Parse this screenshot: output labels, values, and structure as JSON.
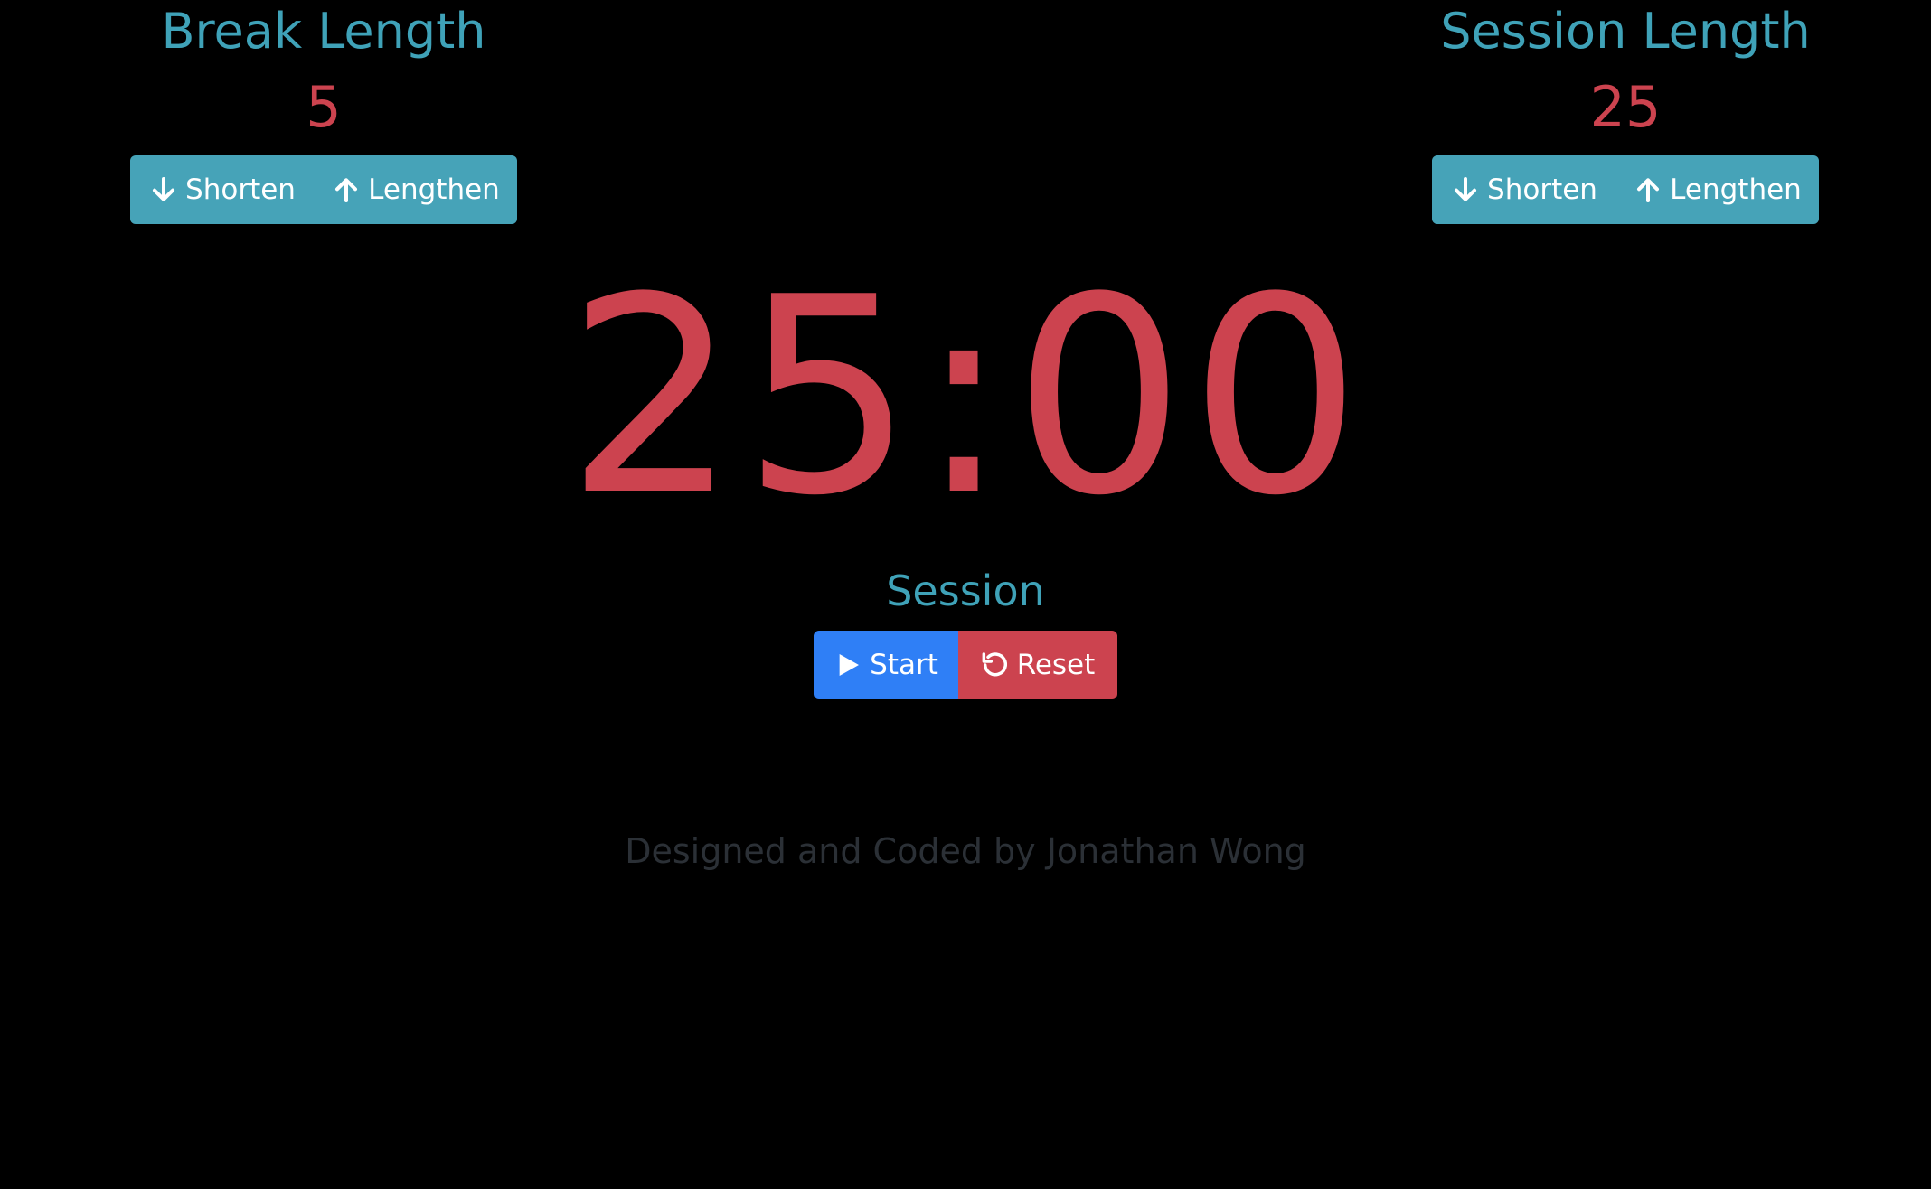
{
  "colors": {
    "background": "#000000",
    "heading": "#3fa2b8",
    "value": "#cc434f",
    "info_button": "#46a3b8",
    "primary_button": "#2f7ff6",
    "danger_button": "#cc434f",
    "credit_text": "#2b3036"
  },
  "break_panel": {
    "title": "Break Length",
    "value": "5",
    "shorten_label": "Shorten",
    "lengthen_label": "Lengthen"
  },
  "session_panel": {
    "title": "Session Length",
    "value": "25",
    "shorten_label": "Shorten",
    "lengthen_label": "Lengthen"
  },
  "timer": {
    "display": "25:00",
    "mode": "Session"
  },
  "controls": {
    "start_label": "Start",
    "reset_label": "Reset"
  },
  "footer": {
    "credit": "Designed and Coded by Jonathan Wong"
  },
  "icons": {
    "shorten": "arrow-down-icon",
    "lengthen": "arrow-up-icon",
    "start": "play-icon",
    "reset": "reset-icon"
  }
}
